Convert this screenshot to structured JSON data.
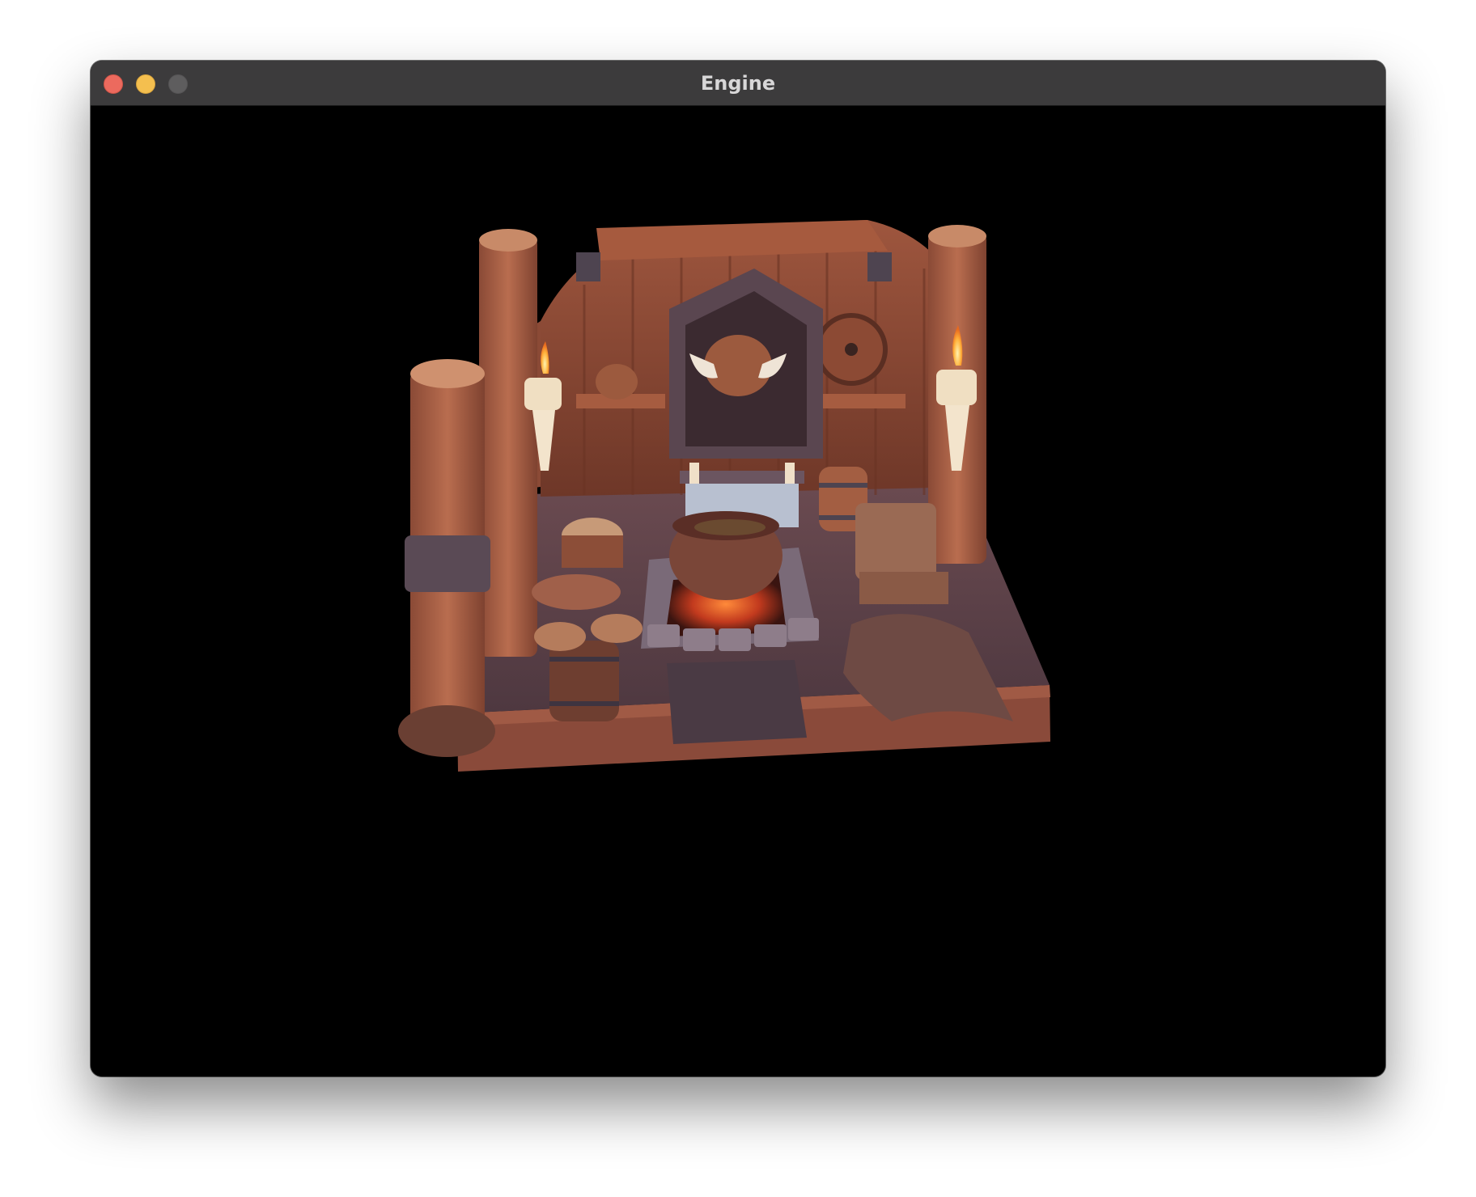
{
  "window": {
    "title": "Engine",
    "controls": [
      "close",
      "minimize",
      "maximize"
    ]
  },
  "viewport": {
    "background": "#000000",
    "content": "3d-rendered-viking-room-diorama"
  },
  "colors": {
    "titlebar": "#3c3b3c",
    "close": "#ec6a5e",
    "minimize": "#f4bf4f",
    "maximize_inactive": "#5e5d5e",
    "wood": "#b0654a",
    "stone": "#6b5560",
    "fire": "#ff6a2a"
  }
}
